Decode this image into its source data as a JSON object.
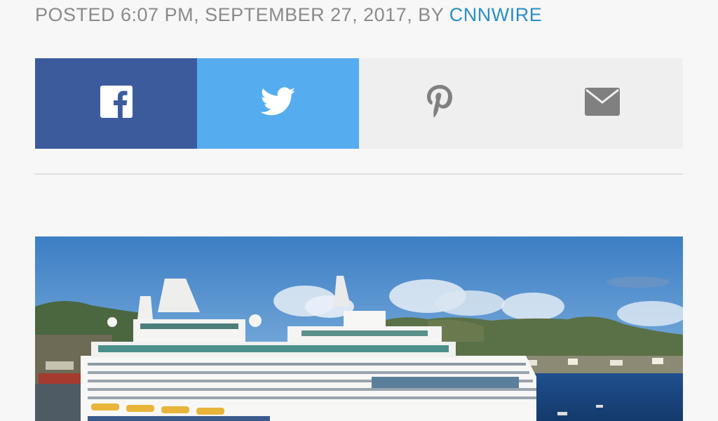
{
  "article": {
    "byline_prefix": "POSTED 6:07 PM, SEPTEMBER 27, 2017, BY ",
    "author": "CNNWIRE"
  },
  "share": {
    "buttons": [
      {
        "network": "facebook",
        "icon": "facebook-icon",
        "color": "#3b5b9d"
      },
      {
        "network": "twitter",
        "icon": "twitter-icon",
        "color": "#55acee"
      },
      {
        "network": "pinterest",
        "icon": "pinterest-icon",
        "color": "#efefef"
      },
      {
        "network": "email",
        "icon": "email-icon",
        "color": "#efefef"
      }
    ]
  },
  "hero_image": {
    "subject": "cruise ship docked at harbor"
  },
  "colors": {
    "author_link": "#2a8fc3",
    "byline_text": "#8a8a8a",
    "page_background": "#f7f7f7"
  }
}
